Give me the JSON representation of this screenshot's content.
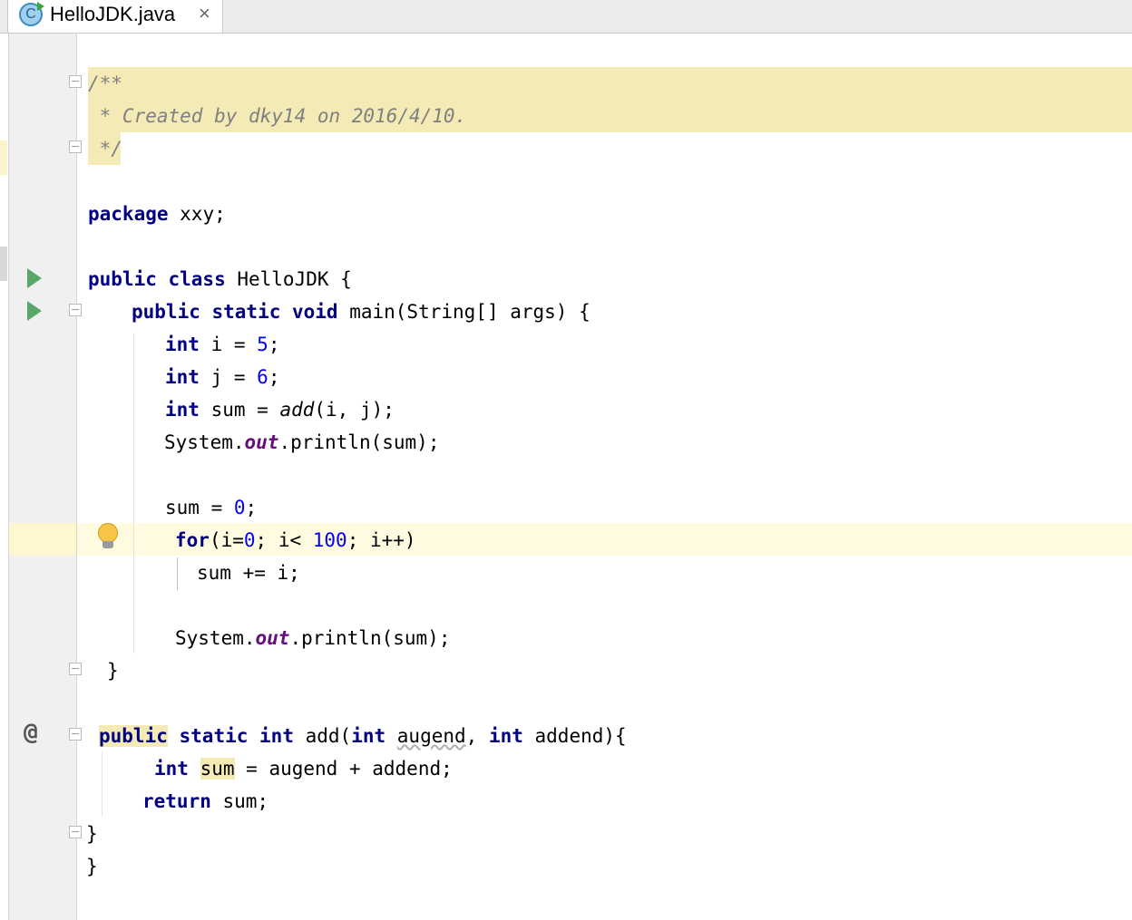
{
  "tab": {
    "title": "HelloJDK.java",
    "close": "×",
    "icon_letter": "C"
  },
  "code": {
    "l1": "/**",
    "l2": " * Created by dky14 on 2016/4/10.",
    "l3": " */",
    "l4_kw": "package",
    "l4_rest": " xxy;",
    "l5_kw": "public class",
    "l5_rest": " HelloJDK {",
    "l6_kw": "public static void",
    "l6_rest": " main(String[] args) {",
    "int_kw": "int",
    "l7_a": " i = ",
    "l7_num": "5",
    "l7_b": ";",
    "l8_a": " j = ",
    "l8_num": "6",
    "l8_b": ";",
    "l9_a": " sum = ",
    "l9_call": "add",
    "l9_b": "(i, j);",
    "system": "System.",
    "out": "out",
    "println": ".println(sum);",
    "l11_a": "sum = ",
    "l11_num": "0",
    "l11_b": ";",
    "for_kw": "for",
    "for_a": "(i=",
    "for_n0": "0",
    "for_b": "; i< ",
    "for_n100": "100",
    "for_c": "; i++)",
    "l13": "sum += i;",
    "close_brace": "}",
    "l16_public": "public",
    "l16_static": "static",
    "l16_int": "int",
    "l16_add": " add(",
    "l16_augend": "augend",
    "l16_comma": ", ",
    "l16_addend": " addend){",
    "l17_sum": "sum",
    "l17_rest": " = augend + addend;",
    "return_kw": "return",
    "return_rest": " sum;",
    "at_symbol": "@"
  }
}
